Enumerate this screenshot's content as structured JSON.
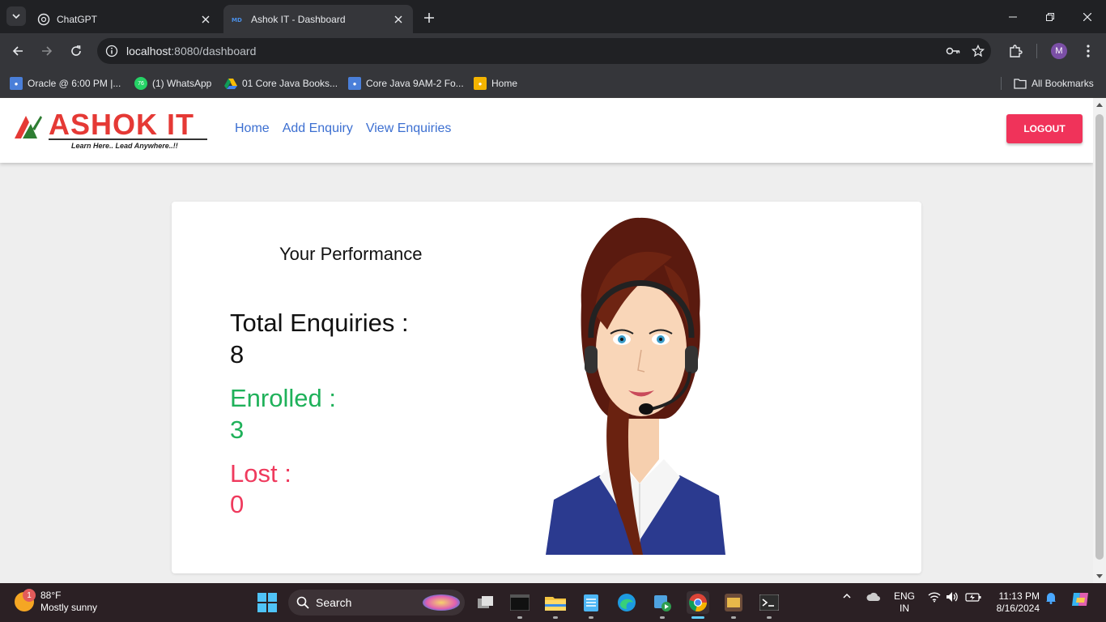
{
  "browser": {
    "tabs": [
      {
        "title": "ChatGPT",
        "active": false
      },
      {
        "title": "Ashok IT - Dashboard",
        "active": true
      }
    ],
    "url_host": "localhost",
    "url_path": ":8080/dashboard",
    "bookmarks": [
      {
        "label": "Oracle @ 6:00 PM |..."
      },
      {
        "label": "(1) WhatsApp"
      },
      {
        "label": "01 Core Java Books..."
      },
      {
        "label": "Core Java 9AM-2 Fo..."
      },
      {
        "label": "Home"
      }
    ],
    "all_bookmarks_label": "All Bookmarks",
    "profile_initial": "M",
    "whatsapp_badge": "76"
  },
  "page": {
    "logo": {
      "brand": "ASHOK IT",
      "tagline": "Learn Here.. Lead Anywhere..!!"
    },
    "nav": [
      {
        "label": "Home"
      },
      {
        "label": "Add Enquiry"
      },
      {
        "label": "View Enquiries"
      }
    ],
    "logout_label": "LOGOUT",
    "performance_title": "Your Performance",
    "stats": {
      "total": {
        "label": "Total Enquiries :",
        "value": "8"
      },
      "enrolled": {
        "label": "Enrolled :",
        "value": "3"
      },
      "lost": {
        "label": "Lost :",
        "value": "0"
      }
    }
  },
  "taskbar": {
    "weather": {
      "temp": "88°F",
      "desc": "Mostly sunny",
      "badge": "1"
    },
    "search_placeholder": "Search",
    "lang_line1": "ENG",
    "lang_line2": "IN",
    "time": "11:13 PM",
    "date": "8/16/2024"
  },
  "colors": {
    "enrolled": "#1fb15a",
    "lost": "#ef3a5d",
    "logout": "#f0335a",
    "link": "#3c6fd1"
  }
}
